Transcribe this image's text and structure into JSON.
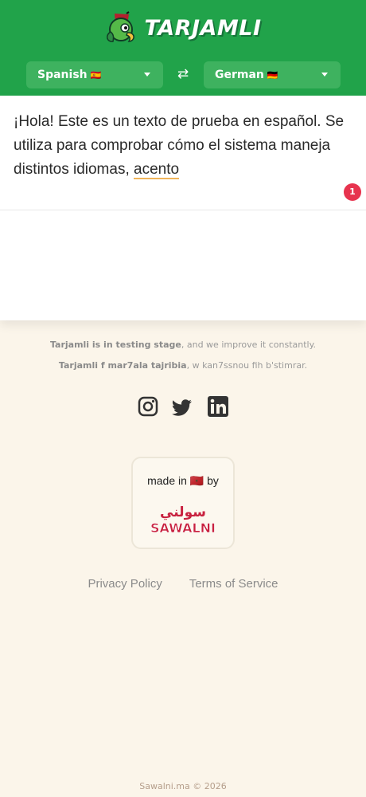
{
  "app": {
    "logo_text": "TARJAMLI"
  },
  "translator": {
    "source_language": "Spanish",
    "source_flag": "🇪🇸",
    "target_language": "German",
    "target_flag": "🇩🇪",
    "source_text_before": "¡Hola! Este es un texto de prueba en español. Se utiliza para comprobar cómo el sistema maneja distintos idiomas, ",
    "source_text_flagged": "acento",
    "issue_count": "1"
  },
  "footer": {
    "testing_bold": "Tarjamli is in testing stage",
    "testing_rest": ", and we improve it constantly.",
    "darija_bold": "Tarjamli f mar7ala tajribia",
    "darija_rest": ", w kan7ssnou fih b'stimrar.",
    "social": [
      "instagram-icon",
      "twitter-icon",
      "linkedin-icon"
    ],
    "made_in_prefix": "made in",
    "made_in_flag": "🇲🇦",
    "made_in_suffix": "by",
    "brand_arabic": "سولني",
    "brand_latin": "SAWALNI",
    "privacy_label": "Privacy Policy",
    "terms_label": "Terms of Service",
    "copyright": "Sawalni.ma © 2026"
  },
  "colors": {
    "header": "#21a34a",
    "language_chip": "#3eb25f",
    "background": "#fbf5ea",
    "badge": "#e7334e",
    "underline": "#f0b45a",
    "brand_red": "#c8213f"
  }
}
